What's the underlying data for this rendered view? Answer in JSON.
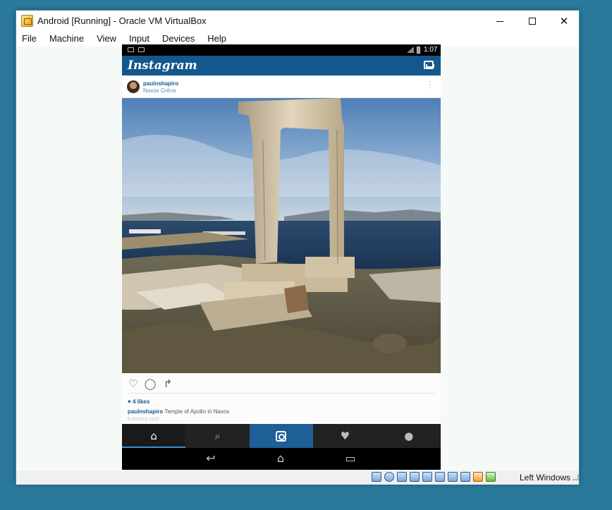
{
  "window": {
    "title": "Android [Running] - Oracle VM VirtualBox",
    "minimize": "–",
    "maximize": "☐",
    "close": "✕"
  },
  "menu": [
    "File",
    "Machine",
    "View",
    "Input",
    "Devices",
    "Help"
  ],
  "android_status": {
    "time": "1:07"
  },
  "instagram": {
    "logo": "Instagram",
    "post": {
      "username": "paulnshapiro",
      "location": "Naxos Grèce",
      "likes": "♥ 4 likes",
      "caption_user": "paulnshapiro",
      "caption_text": " Temple of Apollo in Naxos",
      "time_ago": "5 HOURS AGO"
    },
    "tabs": [
      "home",
      "search",
      "camera",
      "activity",
      "profile"
    ]
  },
  "icons": {
    "heart": "heart-outline-icon",
    "comment": "comment-icon",
    "share": "share-icon",
    "back": "back-icon",
    "home": "home-icon",
    "recent": "recent-apps-icon"
  },
  "vbox_status": {
    "host_key": "Left Windows"
  },
  "colors": {
    "desktop": "#2b7a9d",
    "ig_blue": "#14578d",
    "ig_tab_dark": "#222222",
    "ig_camera_tab": "#1e5f97"
  }
}
